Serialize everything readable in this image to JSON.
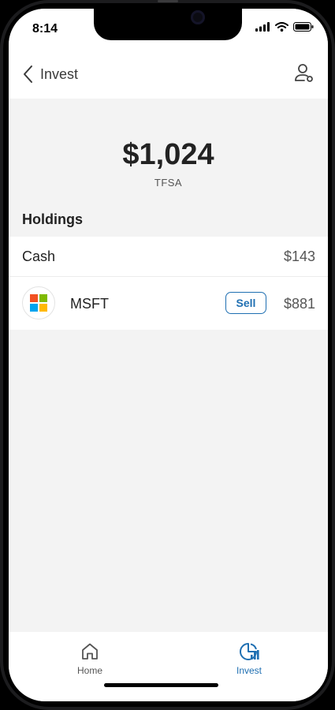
{
  "status_bar": {
    "time": "8:14"
  },
  "nav": {
    "back_label": "Invest",
    "back_icon": "chevron-left-icon",
    "profile_icon": "user-settings-icon"
  },
  "account": {
    "balance": "$1,024",
    "account_type": "TFSA"
  },
  "holdings": {
    "title": "Holdings",
    "cash": {
      "name": "Cash",
      "value": "$143"
    },
    "items": [
      {
        "symbol": "MSFT",
        "logo": "microsoft-logo",
        "sell_label": "Sell",
        "value": "$881"
      }
    ]
  },
  "tab_bar": {
    "tabs": [
      {
        "label": "Home",
        "icon": "home-icon",
        "active": false
      },
      {
        "label": "Invest",
        "icon": "pie-chart-icon",
        "active": true
      }
    ]
  },
  "colors": {
    "accent": "#1f6fb2",
    "ms_red": "#f25022",
    "ms_green": "#7fba00",
    "ms_blue": "#00a4ef",
    "ms_yellow": "#ffb900"
  }
}
